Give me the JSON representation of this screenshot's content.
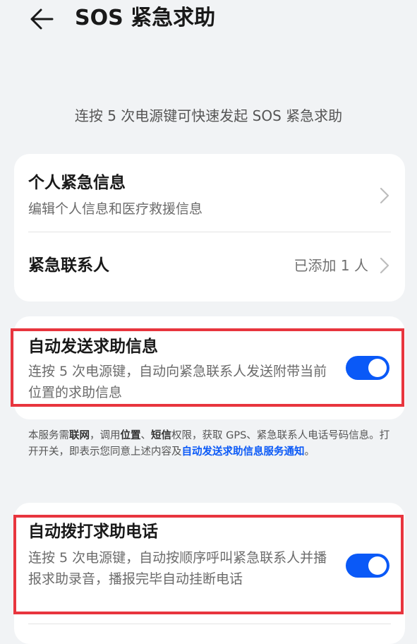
{
  "header": {
    "title": "SOS 紧急求助",
    "back_icon": "arrow-left-icon"
  },
  "subtitle": "连按 5 次电源键可快速发起 SOS 紧急求助",
  "card1": {
    "personal_info": {
      "title": "个人紧急信息",
      "subtitle": "编辑个人信息和医疗救援信息"
    },
    "contacts": {
      "title": "紧急联系人",
      "value": "已添加 1 人"
    }
  },
  "auto_message": {
    "title": "自动发送求助信息",
    "subtitle": "连按 5 次电源键，自动向紧急联系人发送附带当前位置的求助信息",
    "enabled": true
  },
  "notice": {
    "t1": "本服务需",
    "b1": "联网",
    "t2": "，调用",
    "b2": "位置",
    "t3": "、",
    "b3": "短信",
    "t4": "权限，获取 GPS、紧急联系人电话号码信息。打开开关，即表示您同意上述内容及",
    "link": "自动发送求助信息服务通知",
    "t5": "。"
  },
  "auto_call": {
    "title": "自动拨打求助电话",
    "subtitle": "连按 5 次电源键，自动按顺序呼叫紧急联系人并播报求助录音，播报完毕自动挂断电话",
    "enabled": true
  },
  "colors": {
    "accent": "#0a59f7",
    "highlight": "#e8353e",
    "background": "#f1f3f5",
    "card": "#ffffff"
  }
}
